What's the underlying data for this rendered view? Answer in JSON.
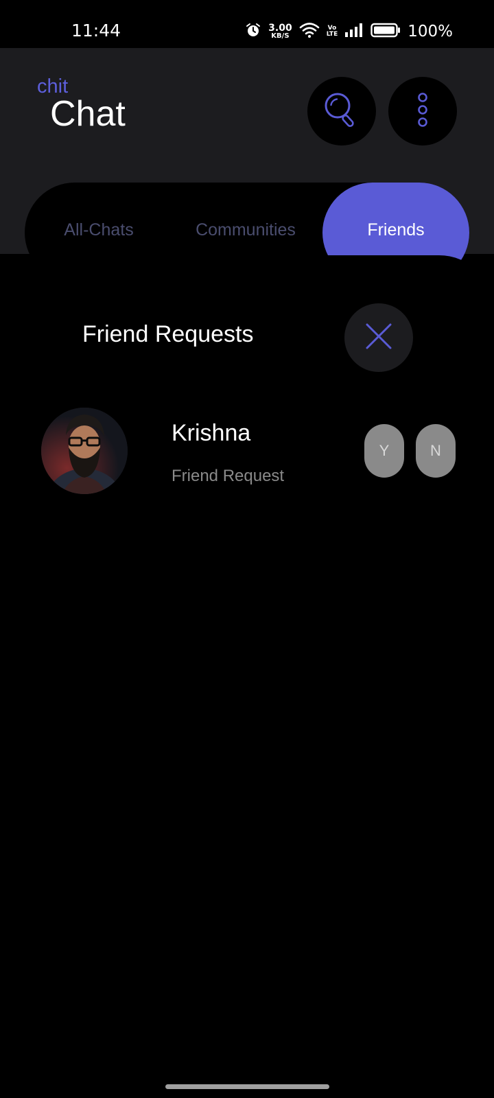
{
  "status_bar": {
    "time": "11:44",
    "network_speed_value": "3.00",
    "network_speed_unit": "KB/S",
    "volte_top": "Vo",
    "volte_bottom": "LTE",
    "battery_percent": "100%",
    "icons": [
      "alarm-icon",
      "wifi-icon",
      "signal-icon",
      "battery-icon"
    ]
  },
  "header": {
    "logo_small": "chit",
    "logo_big": "Chat",
    "search_icon": "search-icon",
    "menu_icon": "more-vertical-icon"
  },
  "tabs": [
    {
      "label": "All-Chats",
      "active": false
    },
    {
      "label": "Communities",
      "active": false
    },
    {
      "label": "Friends",
      "active": true
    }
  ],
  "panel": {
    "title": "Friend Requests",
    "close_icon": "close-icon",
    "requests": [
      {
        "name": "Krishna",
        "subtitle": "Friend Request",
        "accept_label": "Y",
        "decline_label": "N"
      }
    ]
  },
  "colors": {
    "accent": "#5a5bd6",
    "header_bg": "#1c1c1f",
    "panel_bg": "#000000",
    "muted_text": "#8a8a8a",
    "inactive_tab": "#4a4d6e",
    "pill_bg": "#8a8a8a"
  }
}
